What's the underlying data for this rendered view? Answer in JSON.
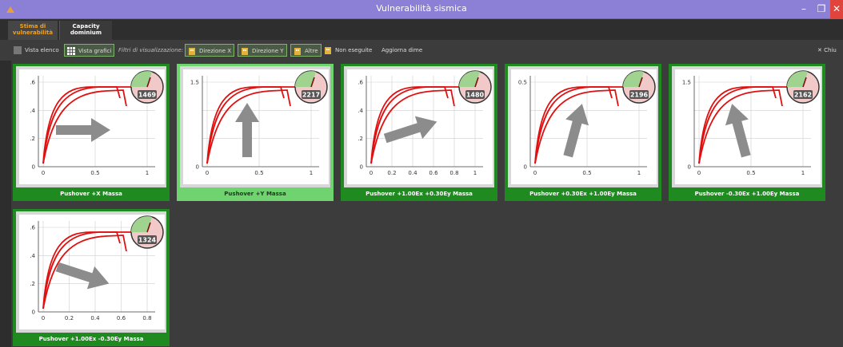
{
  "window": {
    "title": "Vulnerabilità sismica"
  },
  "tabs": [
    {
      "label_line1": "Stima di",
      "label_line2": "vulnerabilità"
    },
    {
      "label_line1": "Capacity",
      "label_line2": "dominium"
    }
  ],
  "toolbar": {
    "list_view": "Vista elenco",
    "chart_view": "Vista grafici",
    "filter_label": "Filtri di visualizzazione:",
    "dir_x": "Direzione X",
    "dir_y": "Direzione Y",
    "others": "Altre",
    "not_run": "Non eseguite",
    "update_dims": "Aggiorna dime",
    "close": "✕ Chiu"
  },
  "colors": {
    "accent_green": "#1f8a1f",
    "selected_green": "#6fd46f",
    "curve_red": "#e01010",
    "arrow_gray": "#8c8c8c"
  },
  "cards": [
    {
      "caption": "Pushover +X Massa",
      "gauge_value": "1469",
      "yticks": [
        ".6",
        ".4",
        ".2",
        "0"
      ],
      "xticks": [
        "0",
        "0.5",
        "1"
      ],
      "arrow": "right",
      "selected": false
    },
    {
      "caption": "Pushover +Y Massa",
      "gauge_value": "2217",
      "yticks": [
        "1.5",
        "",
        "",
        "0"
      ],
      "xticks": [
        "0",
        "0.5",
        "1"
      ],
      "arrow": "up",
      "selected": true
    },
    {
      "caption": "Pushover +1.00Ex +0.30Ey Massa",
      "gauge_value": "1480",
      "yticks": [
        ".6",
        ".4",
        ".2",
        "0"
      ],
      "xticks": [
        "0",
        "0.2",
        "0.4",
        "0.6",
        "0.8",
        "1"
      ],
      "arrow": "up-right",
      "selected": false
    },
    {
      "caption": "Pushover +0.30Ex +1.00Ey Massa",
      "gauge_value": "2196",
      "yticks": [
        "0.5",
        "",
        "",
        "0"
      ],
      "xticks": [
        "0",
        "0.5",
        "1"
      ],
      "arrow": "up-slight-right",
      "selected": false
    },
    {
      "caption": "Pushover -0.30Ex +1.00Ey Massa",
      "gauge_value": "2162",
      "yticks": [
        "1.5",
        "",
        "",
        "0"
      ],
      "xticks": [
        "0",
        "0.5",
        "1"
      ],
      "arrow": "up-slight-left",
      "selected": false
    },
    {
      "caption": "Pushover +1.00Ex -0.30Ey Massa",
      "gauge_value": "1324",
      "yticks": [
        ".6",
        ".4",
        ".2",
        "0"
      ],
      "xticks": [
        "0",
        "0.2",
        "0.4",
        "0.6",
        "0.8"
      ],
      "arrow": "down-right",
      "selected": false
    }
  ]
}
